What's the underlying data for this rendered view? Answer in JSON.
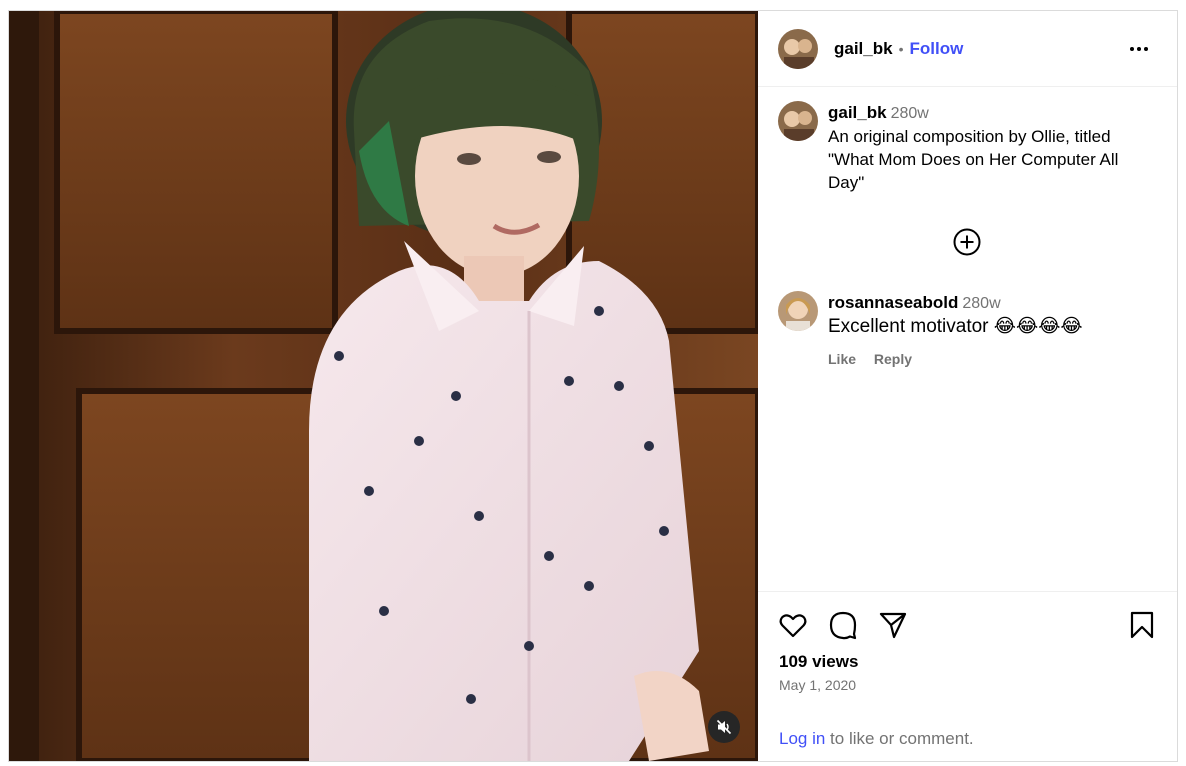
{
  "post": {
    "author": "gail_bk",
    "follow_label": "Follow",
    "separator": "•",
    "more_icon": "more-options-icon"
  },
  "caption": {
    "user": "gail_bk",
    "time": "280w",
    "text": "An original composition by Ollie, titled \"What Mom Does on Her Computer All Day\""
  },
  "comments": [
    {
      "user": "rosannaseabold",
      "time": "280w",
      "text": "Excellent motivator 😂😂😂😂",
      "like_label": "Like",
      "reply_label": "Reply"
    }
  ],
  "actions": {
    "views": "109 views",
    "date": "May 1, 2020",
    "login_link": "Log in",
    "login_rest": " to like or comment."
  },
  "colors": {
    "link": "#4150f7",
    "muted": "#737373",
    "border": "#dbdbdb"
  }
}
